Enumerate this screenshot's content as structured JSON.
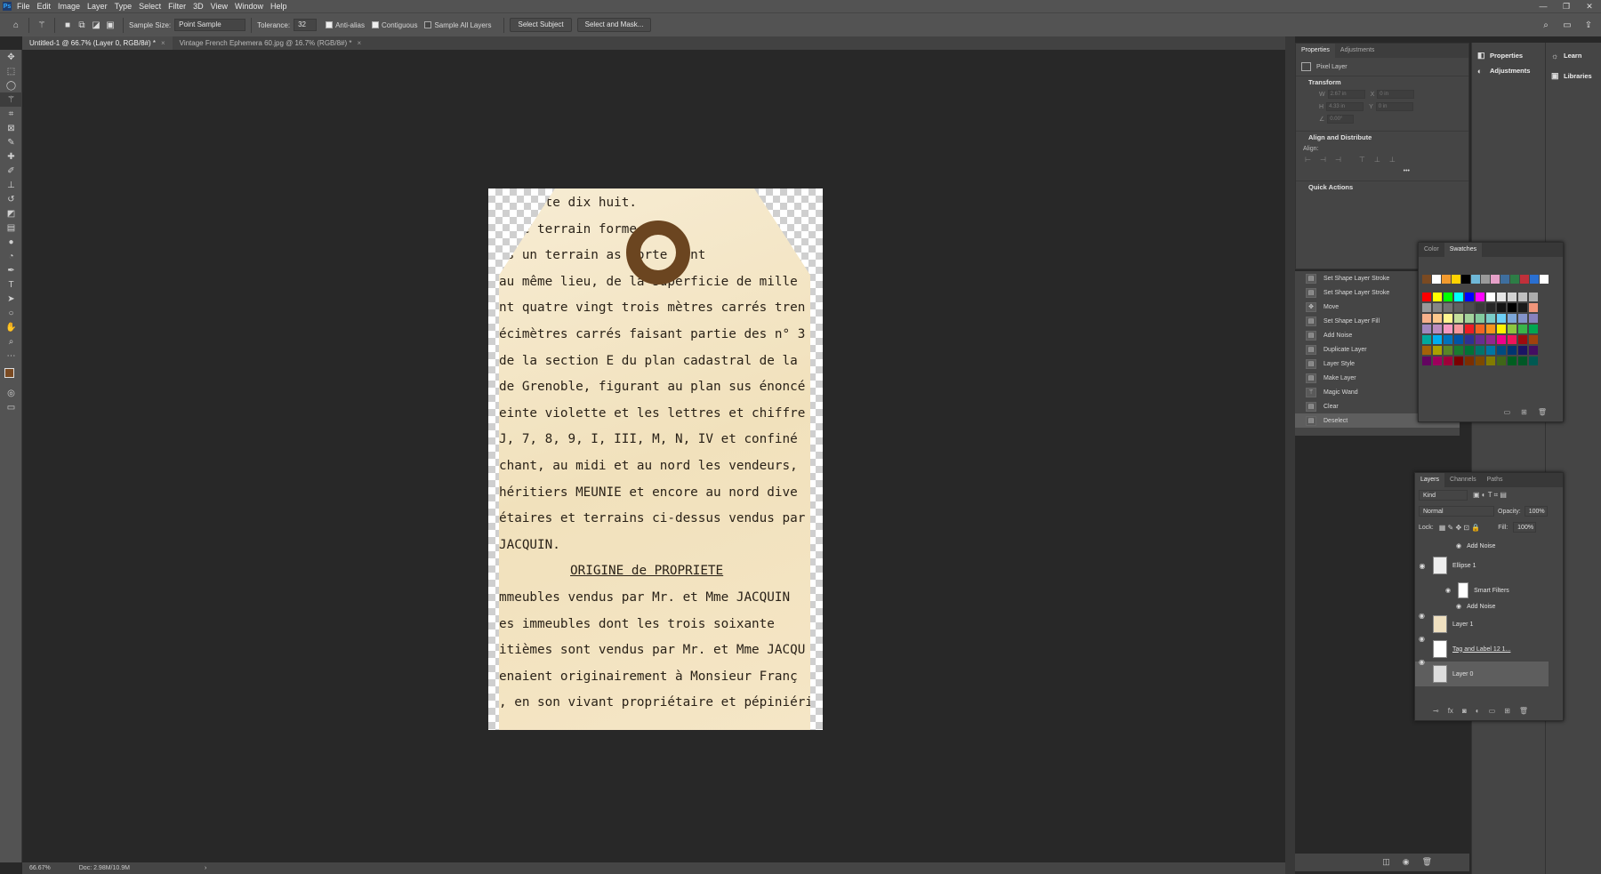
{
  "menubar": {
    "logo": "Ps",
    "items": [
      "File",
      "Edit",
      "Image",
      "Layer",
      "Type",
      "Select",
      "Filter",
      "3D",
      "View",
      "Window",
      "Help"
    ],
    "window_controls": [
      "—",
      "❐",
      "✕"
    ]
  },
  "options": {
    "sample_size_label": "Sample Size:",
    "sample_size_value": "Point Sample",
    "tolerance_label": "Tolerance:",
    "tolerance_value": "32",
    "anti_alias": "Anti-alias",
    "contiguous": "Contiguous",
    "sample_all_layers": "Sample All Layers",
    "select_subject": "Select Subject",
    "select_and_mask": "Select and Mask..."
  },
  "doc_tabs": [
    {
      "label": "Untitled-1 @ 66.7% (Layer 0, RGB/8#) *",
      "close": "×"
    },
    {
      "label": "Vintage French Ephemera 60.jpg @ 16.7% (RGB/8#) *",
      "close": "×"
    }
  ],
  "tag_lines": [
    "      soixante dix huit.",
    "   e de terrain forme irr",
    " ns un terrain    as forte cont",
    "au même lieu, de la superficie de mille",
    "nt quatre vingt trois mètres carrés tren",
    "écimètres carrés faisant partie des n° 3",
    " de la section E du plan cadastral de la",
    "de Grenoble, figurant au plan sus énoncé",
    "einte violette et les lettres et chiffre",
    " J, 7, 8, 9, I, III, M, N, IV et confiné",
    "chant, au midi et au nord les vendeurs,",
    " héritiers MEUNIE et encore au nord dive",
    "étaires et terrains ci-dessus vendus par",
    " JACQUIN.",
    "ORIGINE de PROPRIETE",
    "mmeubles vendus par Mr. et Mme  JACQUIN",
    "es immeubles dont les   trois  soixante",
    "itièmes sont vendus par Mr. et Mme JACQU",
    "enaient originairement à Monsieur  Franç",
    ", en son vivant propriétaire et pépiniéri"
  ],
  "status": {
    "zoom": "66.67%",
    "doc": "Doc: 2.98M/10.9M",
    "arrow": "›"
  },
  "properties": {
    "tabs": [
      "Properties",
      "Adjustments"
    ],
    "kind": "Pixel Layer",
    "transform_title": "Transform",
    "w_label": "W",
    "w": "2.67 in",
    "x_label": "X",
    "x": "0 in",
    "h_label": "H",
    "h": "4.33 in",
    "y_label": "Y",
    "y": "0 in",
    "angle": "0.00°",
    "align_title": "Align and Distribute",
    "align_label": "Align:",
    "more": "•••",
    "quick_title": "Quick Actions"
  },
  "history": [
    {
      "label": "Set Shape Layer Stroke",
      "icon": "▤"
    },
    {
      "label": "Set Shape Layer Stroke",
      "icon": "▤"
    },
    {
      "label": "Move",
      "icon": "✥"
    },
    {
      "label": "Set Shape Layer Fill",
      "icon": "▤"
    },
    {
      "label": "Add Noise",
      "icon": "▤"
    },
    {
      "label": "Duplicate Layer",
      "icon": "▤"
    },
    {
      "label": "Layer Style",
      "icon": "▤"
    },
    {
      "label": "Make Layer",
      "icon": "▤"
    },
    {
      "label": "Magic Wand",
      "icon": "⚚"
    },
    {
      "label": "Clear",
      "icon": "▤"
    },
    {
      "label": "Deselect",
      "icon": "▤"
    }
  ],
  "learn": [
    {
      "label": "Properties",
      "icon": "◧"
    },
    {
      "label": "Adjustments",
      "icon": "◐"
    }
  ],
  "right_buttons": [
    {
      "label": "Learn",
      "icon": "💡"
    },
    {
      "label": "Libraries",
      "icon": "▣"
    }
  ],
  "swatch_tabs": [
    "Color",
    "Swatches"
  ],
  "swatch_recent": [
    "#7a4a22",
    "#ffffff",
    "#f29a2e",
    "#ffd200",
    "#000000",
    "#6fb8d8",
    "#9a9a9a",
    "#e6a0c8",
    "#3e6e9e",
    "#2d7d46",
    "#c0303a",
    "#2a6fd0",
    "#ffffff"
  ],
  "swatch_rows": [
    [
      "#ff0000",
      "#ffff00",
      "#00ff00",
      "#00ffff",
      "#0000ff",
      "#ff00ff",
      "#ffffff",
      "#e6e6e6",
      "#d2d2d2",
      "#bfbfbf",
      "#acacac"
    ],
    [
      "#999999",
      "#868686",
      "#737373",
      "#606060",
      "#4d4d4d",
      "#3a3a3a",
      "#272727",
      "#141414",
      "#000000",
      "#1a1a1a",
      "#f0957a"
    ],
    [
      "#f7b08a",
      "#fcc88c",
      "#fff690",
      "#c4df9b",
      "#a3d39c",
      "#82ca9d",
      "#7accc8",
      "#6dcff6",
      "#7da7d9",
      "#8393ca",
      "#8781bd"
    ],
    [
      "#a187be",
      "#bc8dbf",
      "#f49ac2",
      "#f6989d",
      "#ed1c24",
      "#f26522",
      "#f7941d",
      "#fff200",
      "#8dc63f",
      "#39b54a",
      "#00a651"
    ],
    [
      "#00a99d",
      "#00aeef",
      "#0072bc",
      "#0054a6",
      "#2e3192",
      "#662d91",
      "#92278f",
      "#ec008c",
      "#ed145b",
      "#9e0b0f",
      "#a0410d"
    ],
    [
      "#a36209",
      "#aba000",
      "#598527",
      "#197b30",
      "#007236",
      "#00746b",
      "#0076a3",
      "#004b80",
      "#003471",
      "#1b1464",
      "#440e62"
    ],
    [
      "#630460",
      "#9e005d",
      "#9e0039",
      "#790000",
      "#7b2e00",
      "#7d4900",
      "#827b00",
      "#406618",
      "#005e20",
      "#005826",
      "#005952"
    ]
  ],
  "layers": {
    "tabs": [
      "Layers",
      "Channels",
      "Paths"
    ],
    "kind": "Kind",
    "blend": "Normal",
    "opacity_label": "Opacity:",
    "opacity": "100%",
    "lock_label": "Lock:",
    "fill_label": "Fill:",
    "fill": "100%",
    "items": [
      {
        "label": "Add Noise",
        "type": "filter"
      },
      {
        "label": "Ellipse 1",
        "type": "layer"
      },
      {
        "label": "Smart Filters",
        "type": "smart"
      },
      {
        "label": "Add Noise",
        "type": "filter"
      },
      {
        "label": "Layer 1",
        "type": "layer"
      },
      {
        "label": "Tag and Label 12 1...",
        "type": "layer"
      },
      {
        "label": "Layer 0",
        "type": "layer"
      }
    ]
  },
  "colors": {
    "accent": "#31a8ff",
    "hole": "#6b4520",
    "foreground": "#7a4a22"
  }
}
